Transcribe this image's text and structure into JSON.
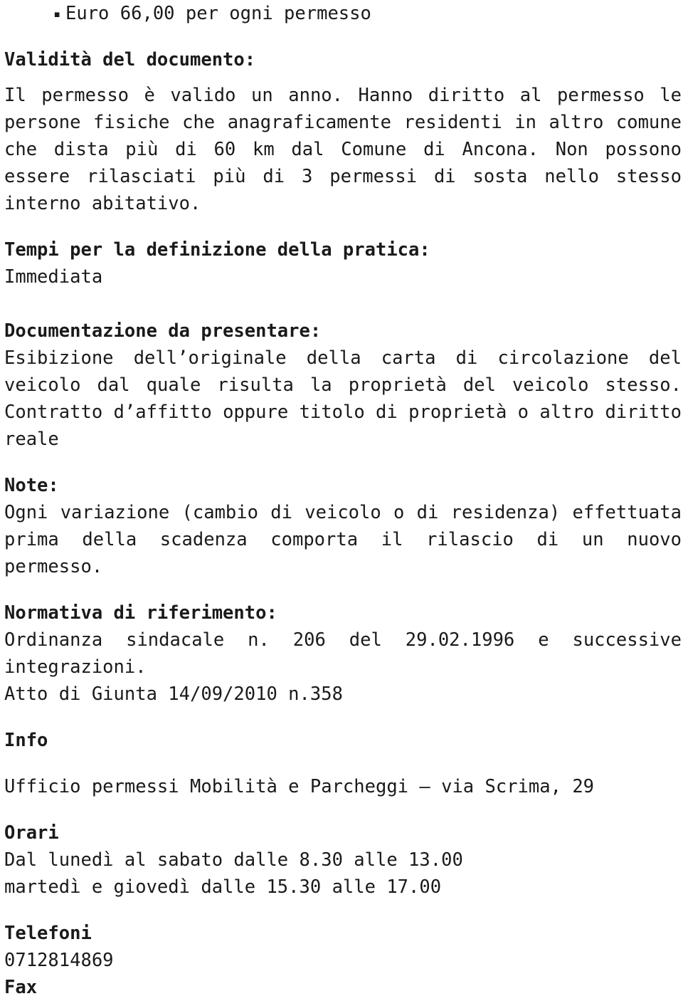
{
  "document": {
    "language": "it",
    "fee_bullet": {
      "marker": "▪",
      "text": "Euro 66,00 per ogni permesso"
    },
    "sections": [
      {
        "id": "validita",
        "heading": "Validità del documento:",
        "lines": [
          "Il permesso è valido un anno. Hanno diritto al permesso le",
          "persone fisiche che anagraficamente residenti in altro comune",
          "che dista più di 60 km dal Comune di Ancona. Non possono",
          "essere rilasciati più di 3 permessi di sosta nello stesso",
          "interno abitativo."
        ]
      },
      {
        "id": "tempi",
        "heading": "Tempi per la definizione della pratica:",
        "lines": [
          "Immediata"
        ]
      },
      {
        "id": "documentazione",
        "heading": "Documentazione da presentare:",
        "lines": [
          "Esibizione dell’originale della carta di circolazione del",
          "veicolo dal quale risulta la proprietà del veicolo stesso.",
          "Contratto d’affitto oppure titolo di proprietà o altro diritto",
          "reale"
        ]
      },
      {
        "id": "note",
        "heading": "Note:",
        "lines": [
          "Ogni variazione (cambio di veicolo o di residenza) effettuata",
          "prima della scadenza comporta il rilascio di un nuovo",
          "permesso."
        ]
      },
      {
        "id": "normativa",
        "heading": "Normativa di riferimento:",
        "lines": [
          "Ordinanza sindacale n. 206 del 29.02.1996 e successive",
          "integrazioni.",
          "Atto di Giunta 14/09/2010 n.358"
        ]
      },
      {
        "id": "info",
        "heading": "Info",
        "lines": [
          "Ufficio permessi Mobilità e Parcheggi – via Scrima, 29"
        ]
      },
      {
        "id": "orari",
        "heading": "Orari",
        "lines": [
          "Dal lunedì al sabato dalle 8.30 alle 13.00",
          "martedì e giovedì dalle 15.30 alle 17.00"
        ]
      },
      {
        "id": "telefoni",
        "heading": "Telefoni",
        "lines": [
          "0712814869"
        ]
      },
      {
        "id": "fax",
        "heading": "Fax",
        "lines": []
      }
    ]
  }
}
